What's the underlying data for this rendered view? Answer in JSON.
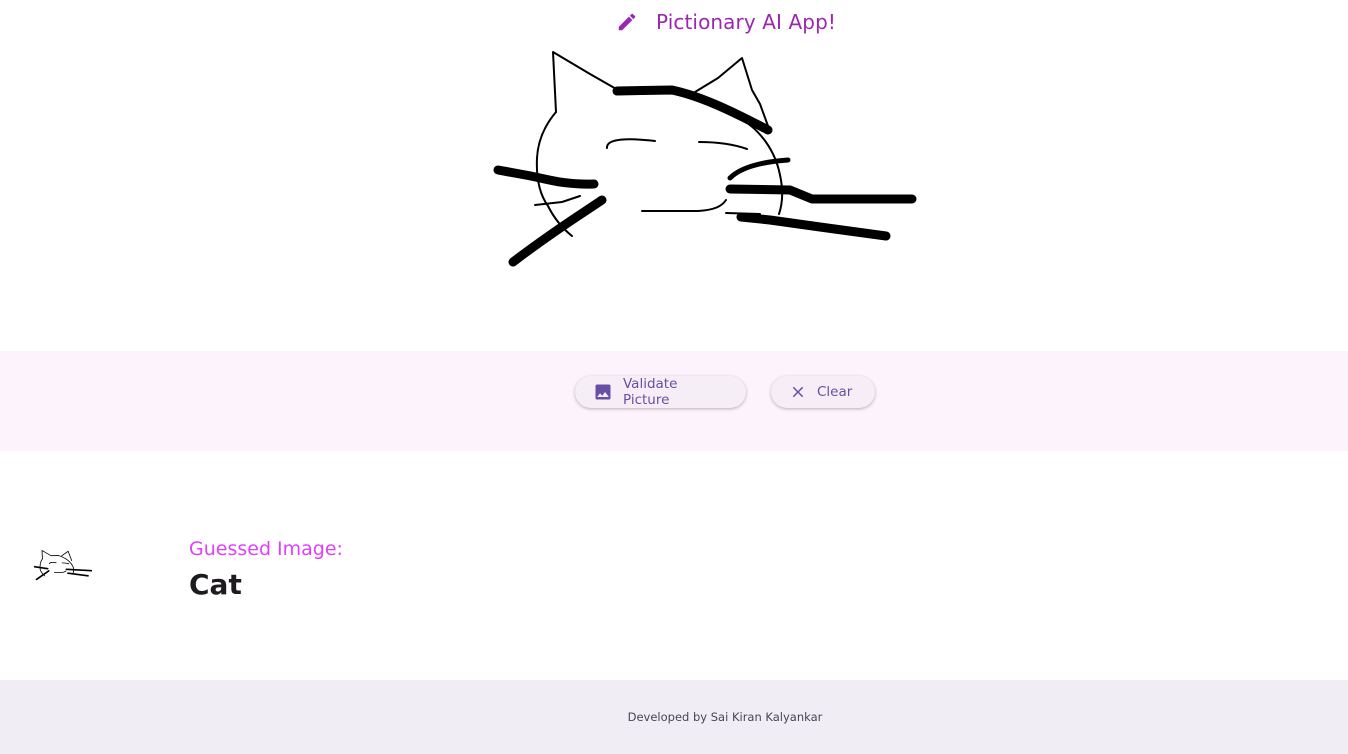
{
  "header": {
    "icon": "pencil-icon",
    "title": "Pictionary AI App!",
    "accent_color": "#9c27b0"
  },
  "canvas": {
    "stroke_color": "#000000"
  },
  "actions": {
    "validate": {
      "label": "Validate Picture",
      "icon": "image-icon"
    },
    "clear": {
      "label": "Clear",
      "icon": "close-icon"
    },
    "label_color": "#6750a4"
  },
  "result": {
    "label": "Guessed Image:",
    "value": "Cat",
    "label_color": "#e040fb"
  },
  "footer": {
    "text": "Developed by Sai Kiran Kalyankar"
  }
}
